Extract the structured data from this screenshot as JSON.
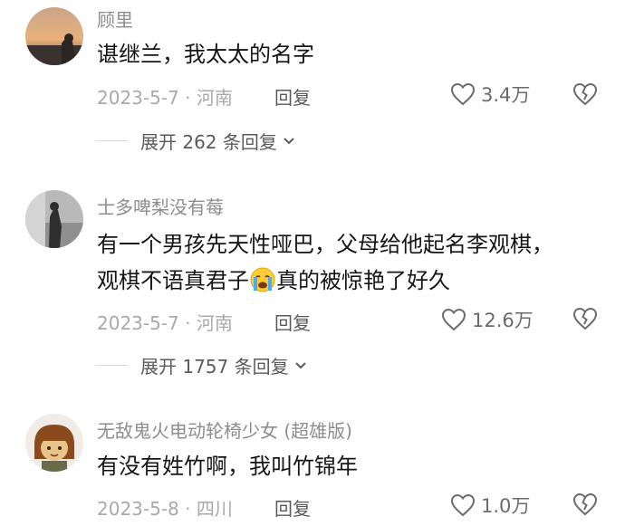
{
  "comments": [
    {
      "username": "顾里",
      "content_line1": "谌继兰，我太太的名字",
      "date_location": "2023-5-7 · 河南",
      "reply_label": "回复",
      "likes": "3.4万",
      "expand_label": "展开 262 条回复"
    },
    {
      "username": "士多啤梨没有莓",
      "content_line1": "有一个男孩先天性哑巴，父母给他起名李观棋，",
      "content_line2_a": "观棋不语真君子",
      "content_line2_b": "真的被惊艳了好久",
      "date_location": "2023-5-7 · 河南",
      "reply_label": "回复",
      "likes": "12.6万",
      "expand_label": "展开 1757 条回复"
    },
    {
      "username": "无敌鬼火电动轮椅少女 (超雄版)",
      "content_line1": "有没有姓竹啊，我叫竹锦年",
      "date_location": "2023-5-8 · 四川",
      "reply_label": "回复",
      "likes": "1.0万"
    }
  ],
  "icons": {
    "like": "heart-outline-icon",
    "dislike": "broken-heart-icon",
    "expand": "chevron-down-icon",
    "emoji": "crying-face-emoji"
  },
  "colors": {
    "username": "#8d8d8d",
    "content": "#161616",
    "meta": "#a9a9a9",
    "action": "#5a5a5a"
  }
}
